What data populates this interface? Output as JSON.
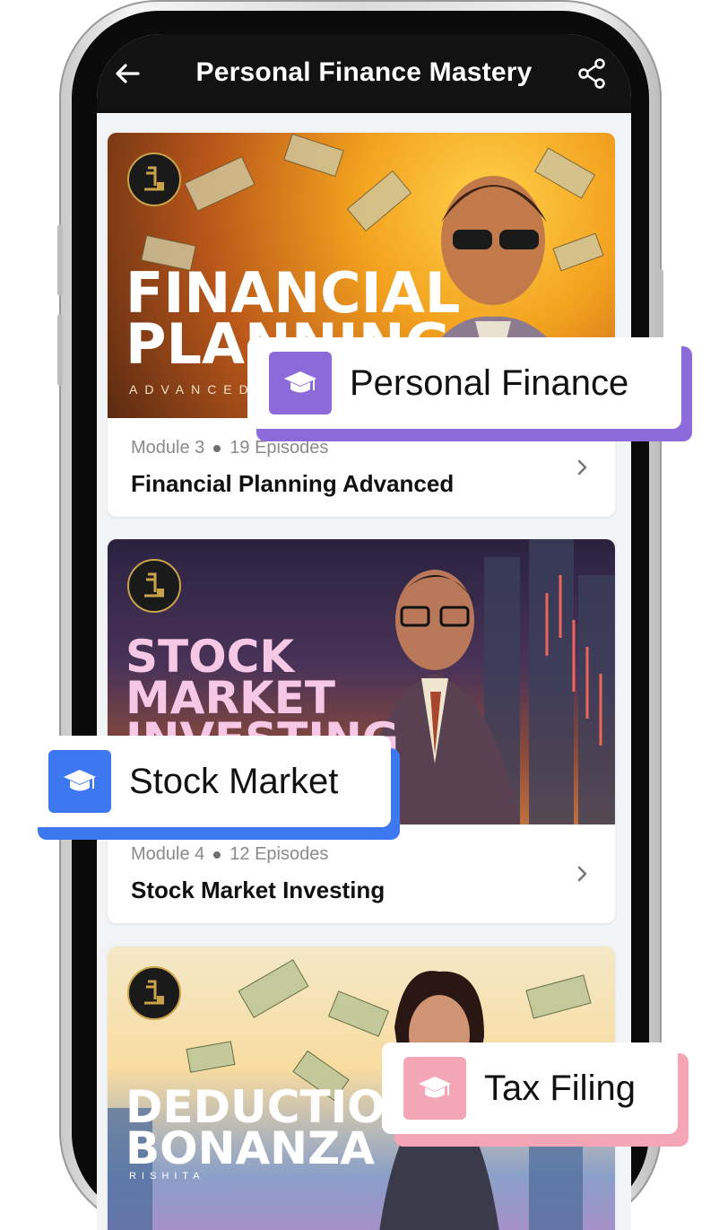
{
  "header": {
    "title": "Personal Finance Mastery"
  },
  "courses": [
    {
      "module": "Module 3",
      "episodes": "19 Episodes",
      "title": "Financial Planning Advanced",
      "cover_title": "FINANCIAL\nPLANNING",
      "cover_subtitle": "ADVANCED"
    },
    {
      "module": "Module 4",
      "episodes": "12 Episodes",
      "title": "Stock Market Investing",
      "cover_title": "STOCK\nMARKET\nINVESTING"
    },
    {
      "cover_title": "DEDUCTION\nBONANZA",
      "cover_subtitle": "RISHITA"
    }
  ],
  "tags": [
    {
      "label": "Personal Finance",
      "color": "#8c6ad9"
    },
    {
      "label": "Stock Market",
      "color": "#3d78f0"
    },
    {
      "label": "Tax Filing",
      "color": "#f4a6b6"
    }
  ],
  "colors": {
    "appbar": "#121212",
    "screen_bg": "#f2f3f5",
    "accent_gold": "#c9a24a"
  },
  "icons": {
    "back": "arrow-left-icon",
    "share": "share-icon",
    "chevron": "chevron-right-icon",
    "tag": "graduation-cap-icon"
  }
}
